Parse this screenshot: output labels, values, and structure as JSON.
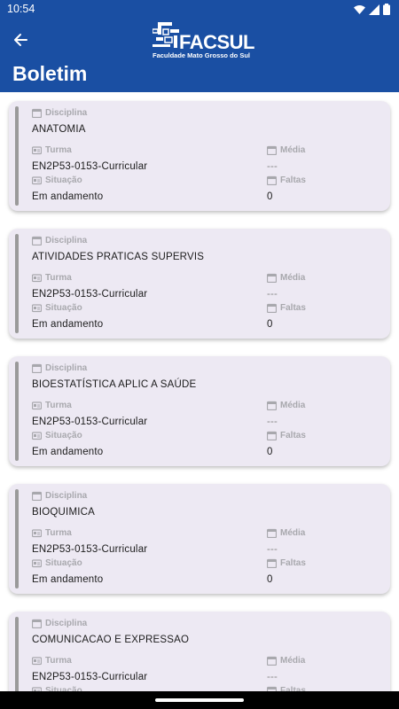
{
  "status_bar": {
    "time": "10:54",
    "icons": [
      "wifi-icon",
      "signal-icon",
      "battery-icon"
    ]
  },
  "header": {
    "back_icon": "arrow-left-icon",
    "logo_text": "FACSUL",
    "logo_subtitle": "Faculdade Mato Grosso do Sul",
    "title": "Boletim"
  },
  "labels": {
    "disciplina": "Disciplina",
    "turma": "Turma",
    "media": "Média",
    "situacao": "Situação",
    "faltas": "Faltas"
  },
  "courses": [
    {
      "disciplina": "ANATOMIA",
      "turma": "EN2P53-0153-Curricular",
      "media": "---",
      "situacao": "Em andamento",
      "faltas": "0"
    },
    {
      "disciplina": "ATIVIDADES PRATICAS SUPERVIS",
      "turma": "EN2P53-0153-Curricular",
      "media": "---",
      "situacao": "Em andamento",
      "faltas": "0"
    },
    {
      "disciplina": "BIOESTATÍSTICA APLIC A SAÚDE",
      "turma": "EN2P53-0153-Curricular",
      "media": "---",
      "situacao": "Em andamento",
      "faltas": "0"
    },
    {
      "disciplina": "BIOQUIMICA",
      "turma": "EN2P53-0153-Curricular",
      "media": "---",
      "situacao": "Em andamento",
      "faltas": "0"
    },
    {
      "disciplina": "COMUNICACAO E EXPRESSAO",
      "turma": "EN2P53-0153-Curricular",
      "media": "---",
      "situacao": "",
      "faltas": ""
    }
  ],
  "colors": {
    "primary": "#1a4fa3",
    "card_bg": "#ede9f3",
    "label": "#a8a8ad",
    "accent_bar": "#9a9a9a"
  }
}
